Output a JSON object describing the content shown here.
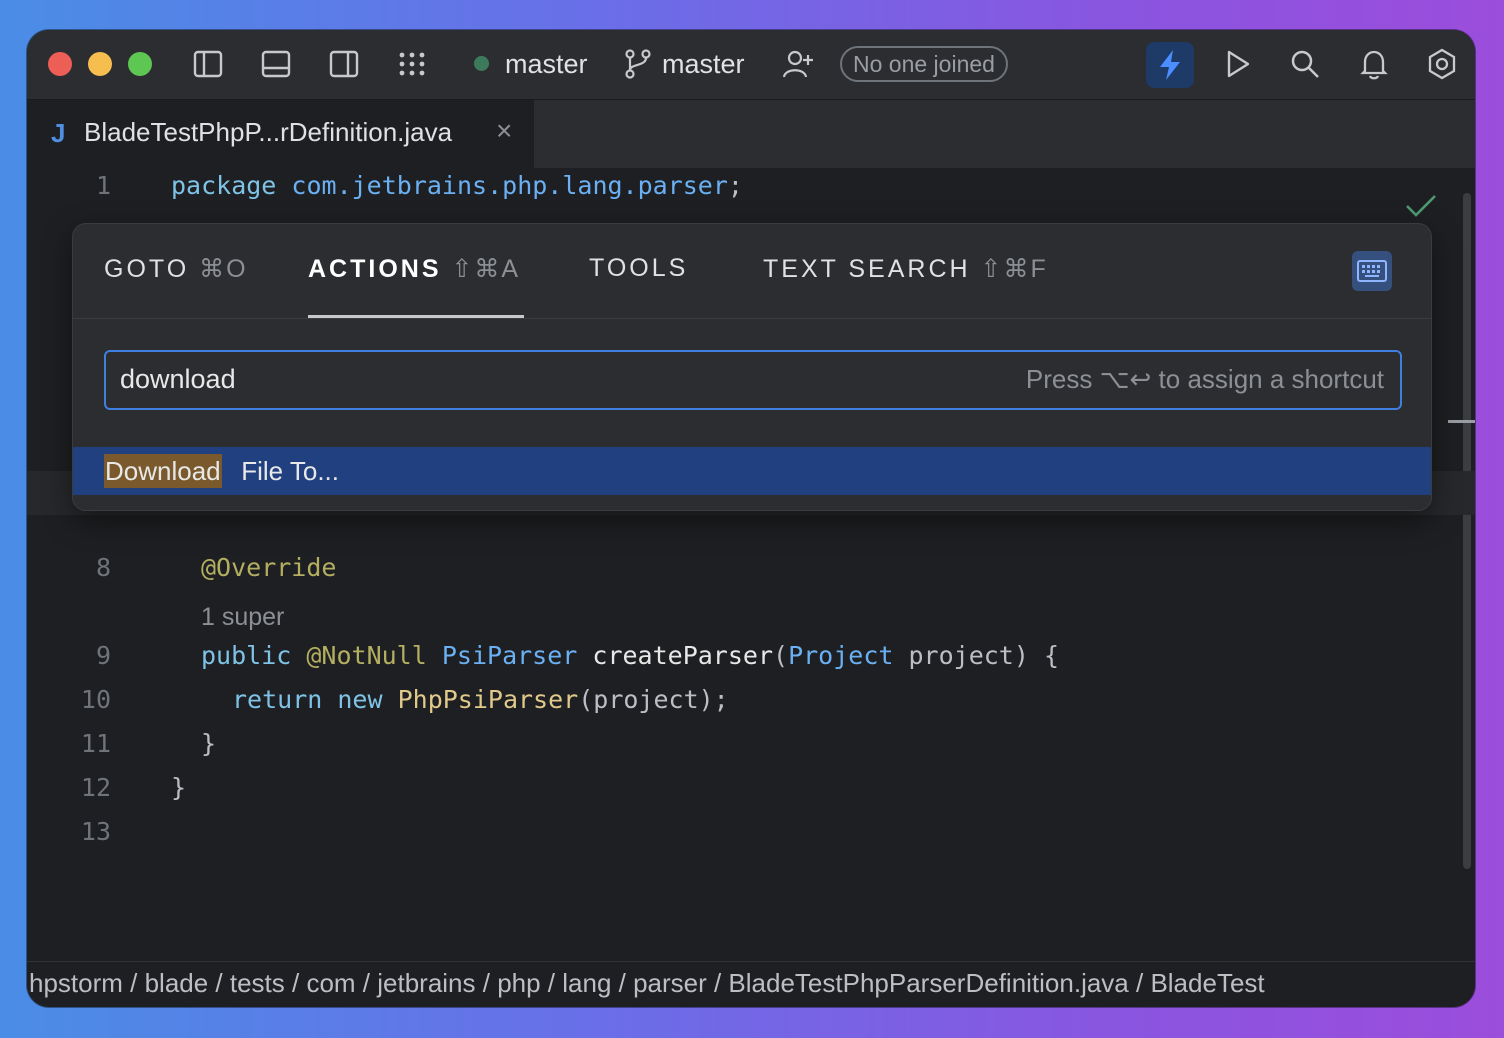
{
  "titlebar": {
    "branch_indicator": "master",
    "vcs_branch": "master",
    "collab_status": "No one joined"
  },
  "tab": {
    "icon_letter": "J",
    "filename": "BladeTestPhpP...rDefinition.java",
    "close": "×"
  },
  "editor": {
    "line1_num": "1",
    "line1_kw": "package",
    "line1_pkg": "com.jetbrains.php.lang.parser",
    "line1_semi": ";",
    "line8_num": "8",
    "line8_ann": "@Override",
    "inlay_hint": "1 super",
    "line9_num": "9",
    "line9_kw": "public",
    "line9_ann": "@NotNull",
    "line9_type": "PsiParser",
    "line9_fn": "createParser",
    "line9_p1": "(",
    "line9_ptype": "Project",
    "line9_rest": " project) {",
    "line10_num": "10",
    "line10_kw": "return",
    "line10_kw2": "new",
    "line10_cls": "PhpPsiParser",
    "line10_rest": "(project);",
    "line11_num": "11",
    "line11_code": "}",
    "line12_num": "12",
    "line12_code": "}",
    "line13_num": "13"
  },
  "popup": {
    "tabs": [
      {
        "label": "GOTO",
        "shortcut": "⌘O"
      },
      {
        "label": "ACTIONS",
        "shortcut": "⇧⌘A"
      },
      {
        "label": "TOOLS",
        "shortcut": ""
      },
      {
        "label": "TEXT SEARCH",
        "shortcut": "⇧⌘F"
      }
    ],
    "search_value": "download",
    "search_hint": "Press ⌥↩ to assign a shortcut",
    "result_highlight": "Download",
    "result_rest": " File To..."
  },
  "breadcrumb": "hpstorm / blade / tests / com / jetbrains / php / lang / parser / BladeTestPhpParserDefinition.java / BladeTest",
  "colors": {
    "accent": "#3f7fe0",
    "selection": "#214080",
    "match_highlight": "#7a5a2c"
  }
}
